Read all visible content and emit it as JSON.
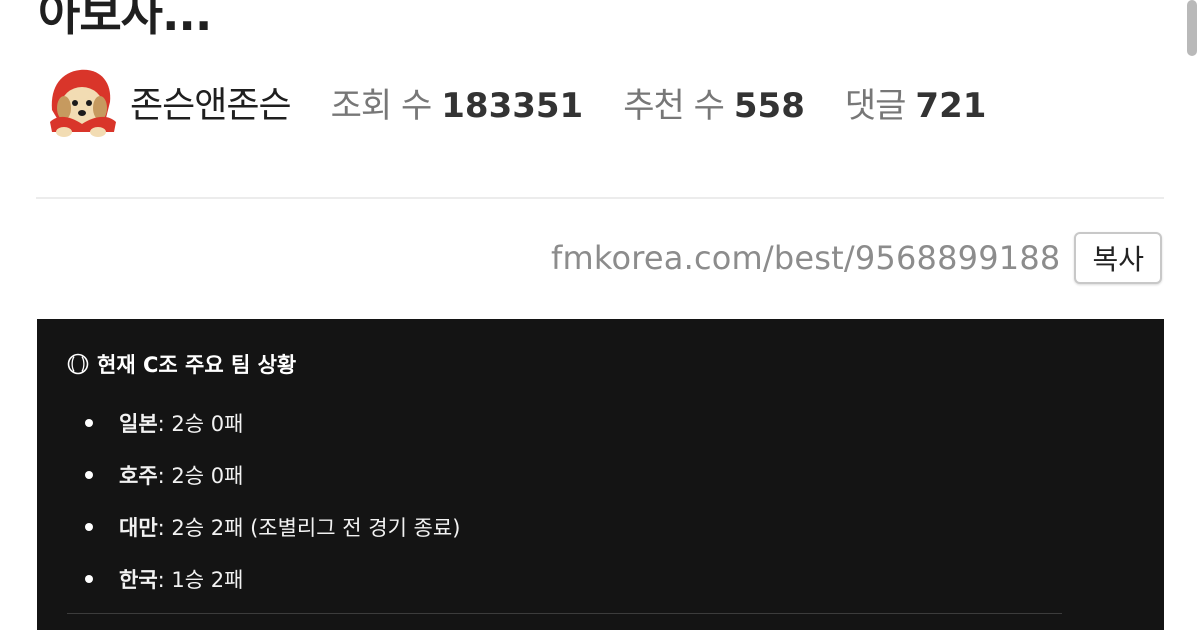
{
  "post": {
    "title_partial": "아보사...",
    "author": "존슨앤존슨",
    "stats": [
      {
        "label": "조회 수",
        "value": "183351"
      },
      {
        "label": "추천 수",
        "value": "558"
      },
      {
        "label": "댓글",
        "value": "721"
      }
    ]
  },
  "share": {
    "url": "fmkorea.com/best/9568899188",
    "copy_label": "복사"
  },
  "content": {
    "heading": "현재 C조 주요 팀 상황",
    "teams": [
      {
        "name": "일본",
        "record": ": 2승 0패"
      },
      {
        "name": "호주",
        "record": ": 2승 0패"
      },
      {
        "name": "대만",
        "record": ": 2승 2패 (조별리그 전 경기 종료)"
      },
      {
        "name": "한국",
        "record": ": 1승 2패"
      }
    ]
  },
  "icons": {
    "avatar": "puppy-red-hood-avatar",
    "heading_icon": "baseball-icon"
  },
  "colors": {
    "content_background": "#141414",
    "url_text": "#8c8c8c",
    "meta_label": "#777777"
  }
}
